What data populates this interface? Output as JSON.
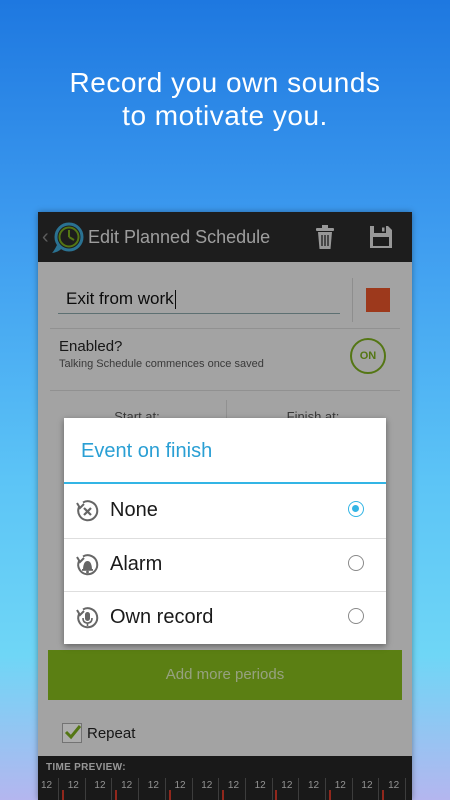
{
  "headline": {
    "line1": "Record you own sounds",
    "line2": "to motivate you."
  },
  "actionbar": {
    "back": "‹",
    "title": "Edit Planned Schedule",
    "logo_icon": "app-clock-logo-icon",
    "delete_icon": "trash-icon",
    "save_icon": "floppy-save-icon"
  },
  "form": {
    "name_value": "Exit from work",
    "color": "#e8542a",
    "enabled_title": "Enabled?",
    "enabled_subtitle": "Talking Schedule commences once saved",
    "toggle_label": "ON",
    "start_label": "Start at:",
    "finish_label": "Finish at:",
    "add_button": "Add more periods",
    "repeat_label": "Repeat",
    "repeat_checked": true
  },
  "timeline": {
    "label": "TIME PREVIEW:",
    "ticks": [
      "12",
      "12",
      "12",
      "12",
      "12",
      "12",
      "12",
      "12",
      "12",
      "12",
      "12",
      "12",
      "12",
      "12"
    ]
  },
  "dialog": {
    "title": "Event on finish",
    "options": [
      {
        "label": "None",
        "icon": "cancel-x-icon",
        "selected": true
      },
      {
        "label": "Alarm",
        "icon": "bell-icon",
        "selected": false
      },
      {
        "label": "Own record",
        "icon": "microphone-icon",
        "selected": false
      }
    ]
  },
  "colors": {
    "accent": "#33b5e5",
    "green": "#86bc1c",
    "actionbar": "#2b2b2b"
  }
}
